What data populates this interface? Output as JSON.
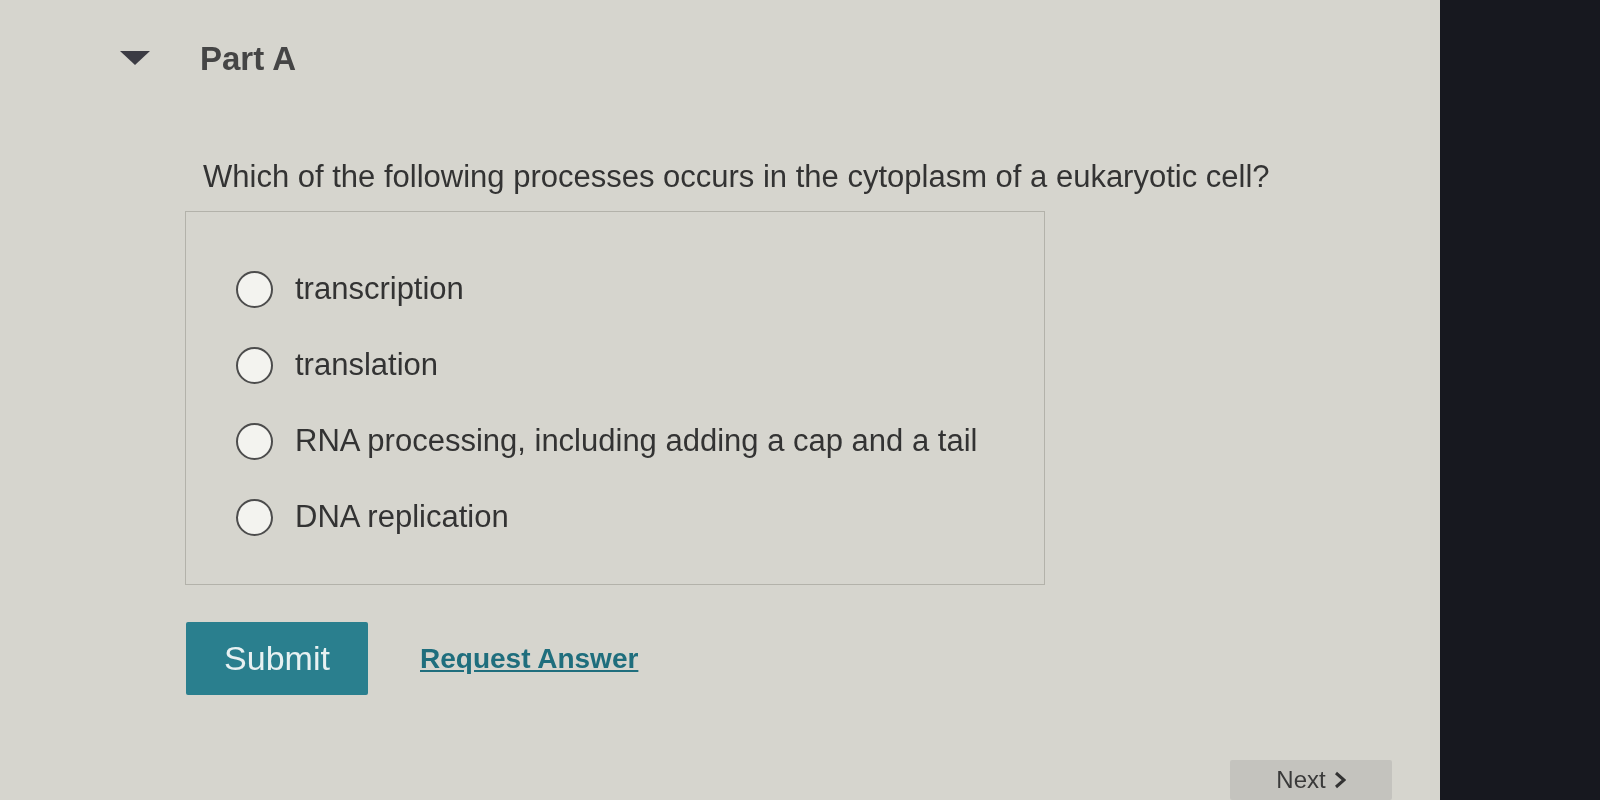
{
  "part": {
    "title": "Part A",
    "expanded": true
  },
  "question": "Which of the following processes occurs in the cytoplasm of a eukaryotic cell?",
  "options": [
    {
      "label": "transcription",
      "selected": false
    },
    {
      "label": "translation",
      "selected": false
    },
    {
      "label": "RNA processing, including adding a cap and a tail",
      "selected": false
    },
    {
      "label": "DNA replication",
      "selected": false
    }
  ],
  "actions": {
    "submit": "Submit",
    "request_answer": "Request Answer"
  },
  "next": {
    "label": "Next"
  }
}
